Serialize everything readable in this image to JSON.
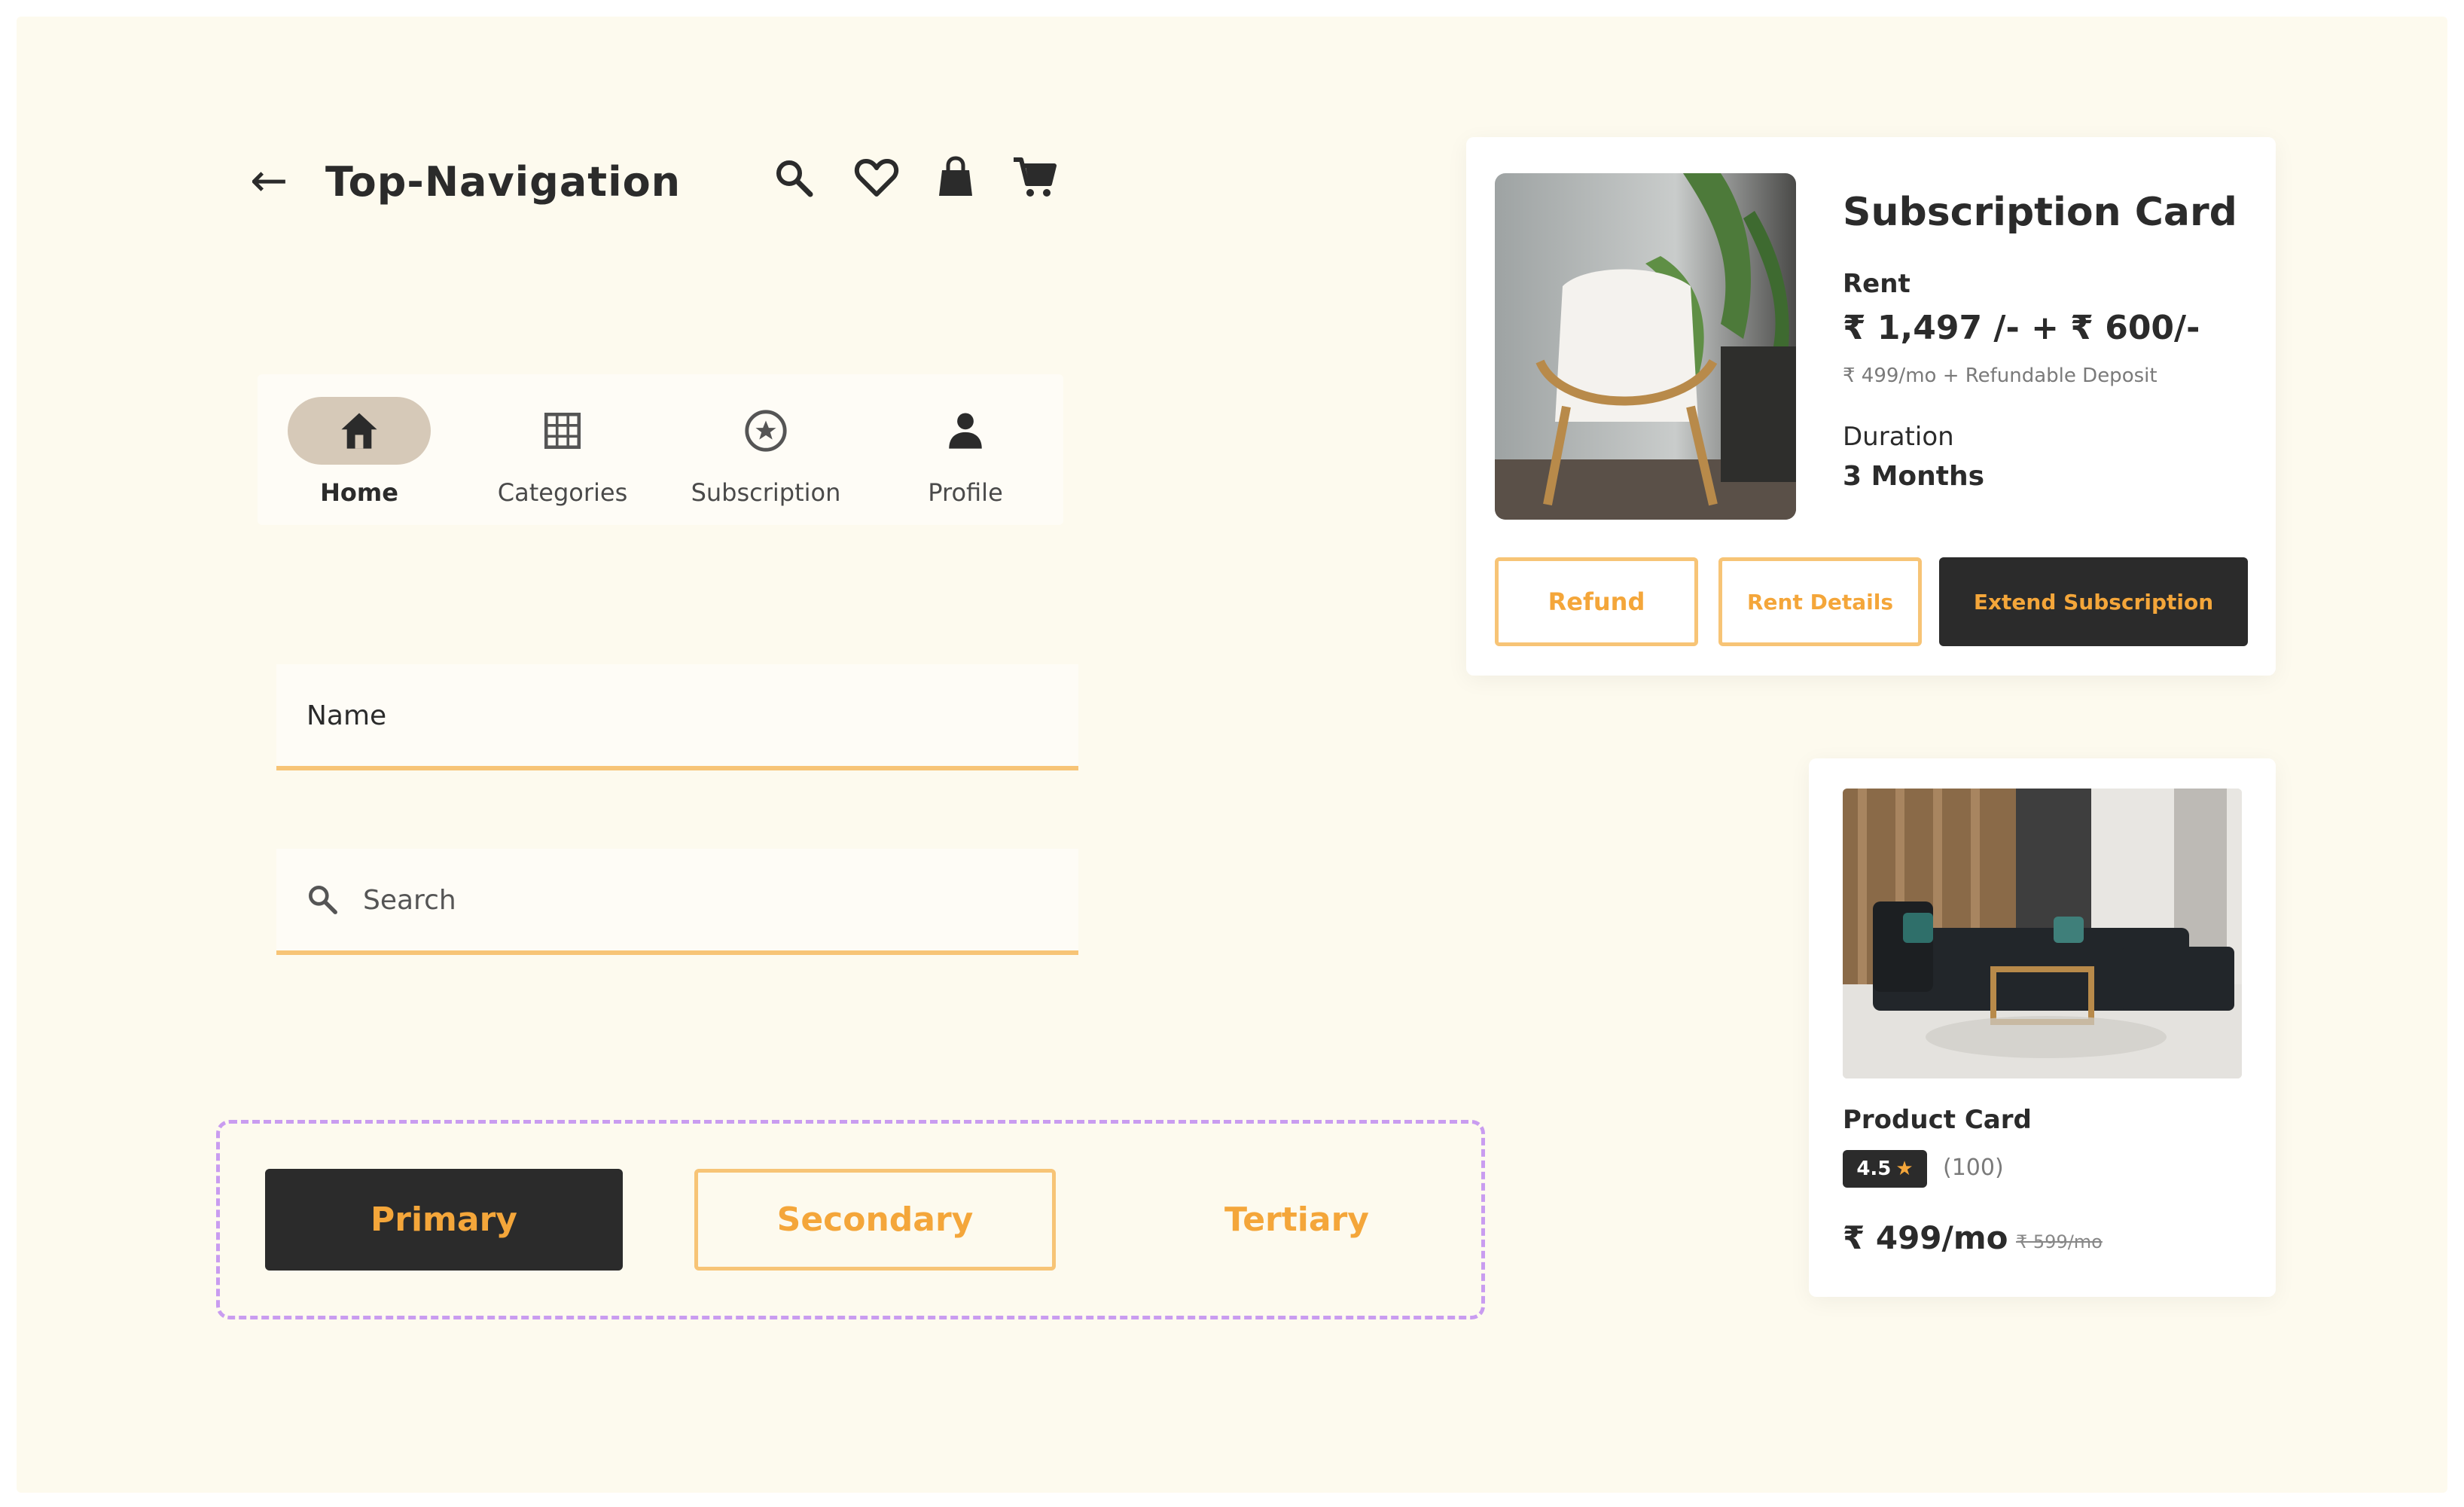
{
  "top_navigation": {
    "back_glyph": "←",
    "title": "Top-Navigation",
    "icons": [
      "search-icon",
      "heart-icon",
      "bag-icon",
      "cart-icon"
    ]
  },
  "bottom_navigation": {
    "items": [
      {
        "label": "Home",
        "icon": "home-icon",
        "active": true
      },
      {
        "label": "Categories",
        "icon": "grid-icon",
        "active": false
      },
      {
        "label": "Subscription",
        "icon": "subscription-icon",
        "active": false
      },
      {
        "label": "Profile",
        "icon": "person-icon",
        "active": false
      }
    ]
  },
  "name_field": {
    "placeholder": "Name"
  },
  "search_field": {
    "placeholder": "Search"
  },
  "buttons": {
    "primary": "Primary",
    "secondary": "Secondary",
    "tertiary": "Tertiary"
  },
  "subscription_card": {
    "title": "Subscription Card",
    "rent_label": "Rent",
    "price": "₹ 1,497 /- + ₹ 600/-",
    "price_note": "₹ 499/mo + Refundable Deposit",
    "duration_label": "Duration",
    "duration": "3 Months",
    "buttons": {
      "refund": "Refund",
      "rent_details": "Rent Details",
      "extend": "Extend Subscription"
    }
  },
  "product_card": {
    "name": "Product Card",
    "rating": "4.5",
    "reviews": "(100)",
    "price": "₹ 499/mo",
    "old_price": "₹ 599/mo"
  },
  "colors": {
    "background": "#fdfaee",
    "accent": "#f4a63a",
    "accent_border": "#f7c476",
    "dark": "#2b2b2b",
    "active_pill": "#d6c9b8",
    "dashed_frame": "#c99cf0"
  }
}
